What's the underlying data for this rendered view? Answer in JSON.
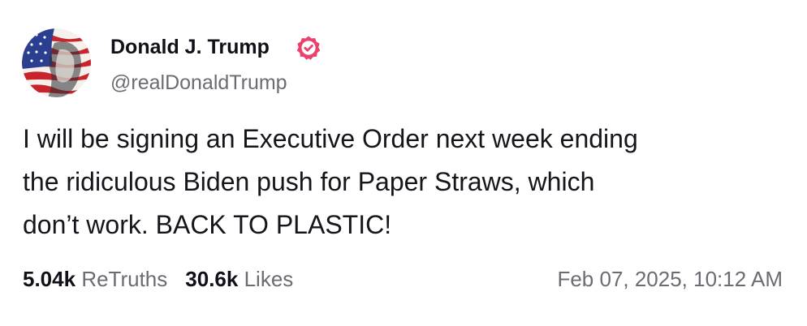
{
  "post": {
    "author": {
      "display_name": "Donald J. Trump",
      "handle": "@realDonaldTrump",
      "verified_icon": "verified-badge-icon",
      "verified_color": "#e8436c"
    },
    "text_lines": [
      "I will be signing an Executive Order next week ending",
      "the ridiculous Biden push for Paper Straws, which",
      "don’t work. BACK TO PLASTIC!"
    ],
    "stats": {
      "retruths_count": "5.04k",
      "retruths_label": "ReTruths",
      "likes_count": "30.6k",
      "likes_label": "Likes"
    },
    "timestamp": "Feb 07, 2025, 10:12 AM"
  }
}
